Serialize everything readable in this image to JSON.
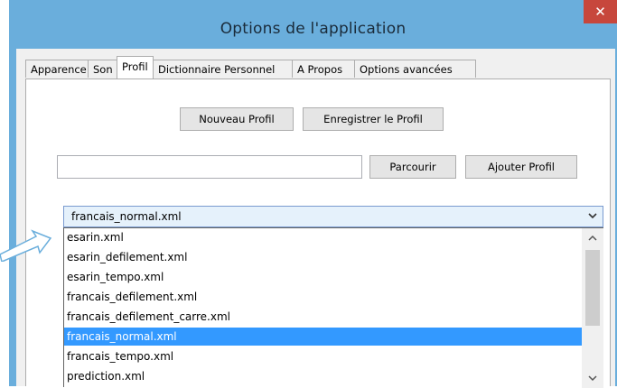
{
  "window": {
    "title": "Options de l'application",
    "close_glyph": "✕"
  },
  "tabs": [
    {
      "label": "Apparence",
      "active": false
    },
    {
      "label": "Son",
      "active": false
    },
    {
      "label": "Profil",
      "active": true
    },
    {
      "label": "Dictionnaire Personnel",
      "active": false
    },
    {
      "label": "A Propos",
      "active": false
    },
    {
      "label": "Options avancées",
      "active": false
    }
  ],
  "profil": {
    "new_profile_button": "Nouveau Profil",
    "save_profile_button": "Enregistrer le Profil",
    "path_input_value": "",
    "browse_button": "Parcourir",
    "add_profile_button": "Ajouter Profil",
    "profile_combo": {
      "selected": "francais_normal.xml",
      "options": [
        "esarin.xml",
        "esarin_defilement.xml",
        "esarin_tempo.xml",
        "francais_defilement.xml",
        "francais_defilement_carre.xml",
        "francais_normal.xml",
        "francais_tempo.xml",
        "prediction.xml"
      ],
      "highlighted_index": 5
    }
  },
  "icons": {
    "close": "close-icon",
    "dropdown": "chevron-down-icon",
    "scroll_up": "chevron-up-icon",
    "scroll_down": "chevron-down-icon",
    "pointer": "arrow-pointer-icon"
  },
  "colors": {
    "titlebar": "#6aaedc",
    "close_button": "#c7473c",
    "selection": "#3399ff",
    "combo_background": "#e5f1fb"
  }
}
